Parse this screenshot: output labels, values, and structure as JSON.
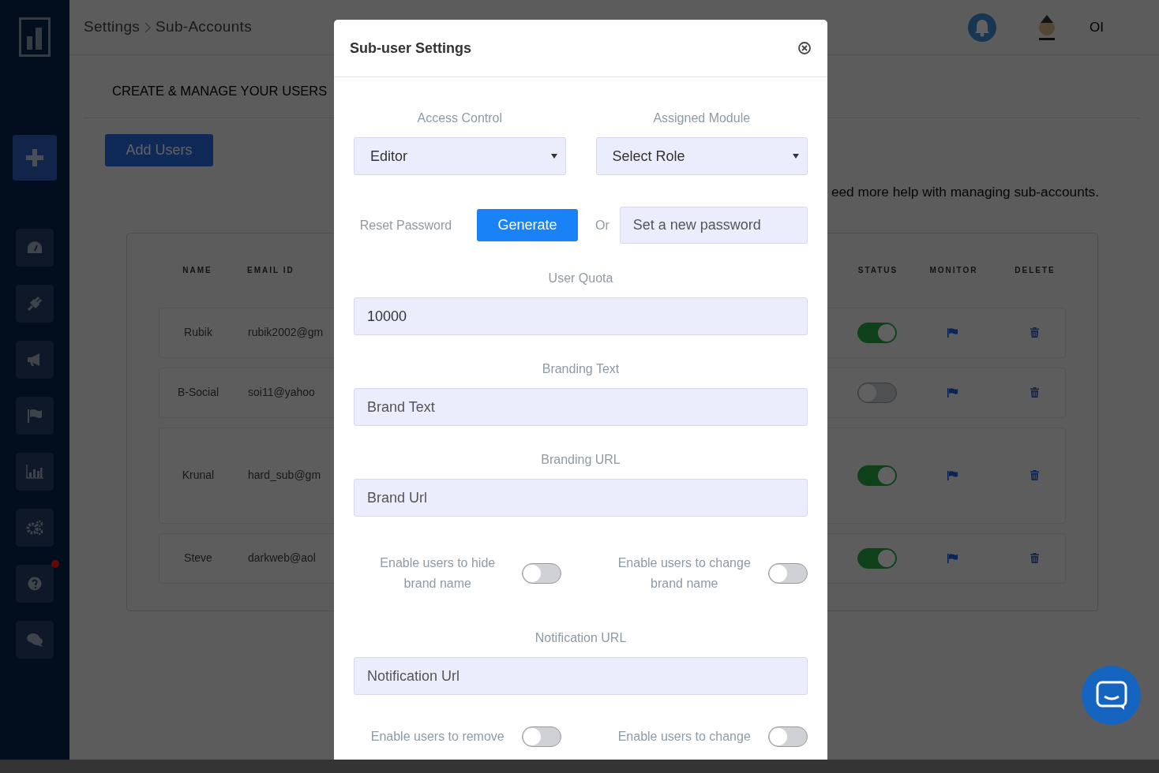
{
  "sidebar": {
    "add_button": {
      "kind": "plus"
    },
    "items": [
      {
        "kind": "gauge",
        "alert": false
      },
      {
        "kind": "plug",
        "alert": false
      },
      {
        "kind": "megaphone",
        "alert": false
      },
      {
        "kind": "flag",
        "alert": false
      },
      {
        "kind": "chart",
        "alert": false
      },
      {
        "kind": "gears",
        "alert": false
      },
      {
        "kind": "help",
        "alert": true
      },
      {
        "kind": "chat",
        "alert": false
      }
    ]
  },
  "breadcrumb": [
    "Settings",
    "Sub-Accounts"
  ],
  "user": {
    "initials": "OI"
  },
  "page": {
    "heading": "CREATE & MANAGE YOUR USERS",
    "add_button": "Add Users",
    "help_text": "eed more help with managing sub-accounts."
  },
  "table": {
    "columns": [
      "NAME",
      "EMAIL ID",
      "STATUS",
      "MONITOR",
      "DELETE"
    ],
    "rows": [
      {
        "name": "Rubik",
        "email": "rubik2002@gm",
        "active": true
      },
      {
        "name": "B-Social",
        "email": "soi11@yahoo",
        "active": false
      },
      {
        "name": "Krunal",
        "email": "hard_sub@gm",
        "active": true
      },
      {
        "name": "Steve",
        "email": "darkweb@aol",
        "active": true
      }
    ]
  },
  "modal": {
    "title": "Sub-user Settings",
    "selects": [
      {
        "label": "Access Control",
        "value": "Editor"
      },
      {
        "label": "Assigned Module",
        "value": "Select Role"
      }
    ],
    "reset": {
      "label": "Reset Password",
      "button": "Generate",
      "or": "Or",
      "placeholder": "Set a new password"
    },
    "fields": [
      {
        "label": "User Quota",
        "value": "10000"
      },
      {
        "label": "Branding Text",
        "placeholder": "Brand Text"
      },
      {
        "label": "Branding URL",
        "placeholder": "Brand Url"
      }
    ],
    "toggles": [
      {
        "label": "Enable users to hide brand name",
        "on": false
      },
      {
        "label": "Enable users to change brand name",
        "on": false
      }
    ],
    "notification": {
      "label": "Notification URL",
      "placeholder": "Notification Url"
    },
    "toggles_more": [
      {
        "label": "Enable users to remove",
        "on": false
      },
      {
        "label": "Enable users to change",
        "on": false
      }
    ]
  }
}
